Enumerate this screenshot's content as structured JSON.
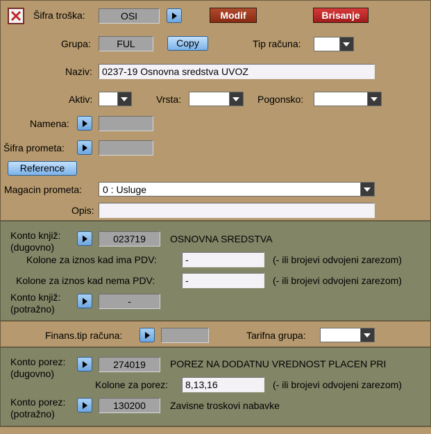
{
  "header": {
    "sifra_label": "Šifra troška:",
    "sifra_value": "OSI",
    "modif_label": "Modif",
    "brisanje_label": "Brisanje"
  },
  "grupa": {
    "label": "Grupa:",
    "value": "FUL",
    "copy_label": "Copy",
    "tip_label": "Tip računa:",
    "tip_value": ""
  },
  "naziv": {
    "label": "Naziv:",
    "value": "0237-19 Osnovna sredstva UVOZ"
  },
  "aktiv": {
    "label": "Aktiv:",
    "value": "",
    "vrsta_label": "Vrsta:",
    "vrsta_value": "",
    "pogonsko_label": "Pogonsko:",
    "pogonsko_value": ""
  },
  "namena": {
    "label": "Namena:",
    "value": ""
  },
  "sifra_prometa": {
    "label": "Šifra prometa:",
    "value": ""
  },
  "reference_label": "Reference",
  "magacin": {
    "label": "Magacin prometa:",
    "value": "0 : Usluge"
  },
  "opis": {
    "label": "Opis:",
    "value": ""
  },
  "konto": {
    "dugovno_label1": "Konto knjiž:",
    "dugovno_label2": "(dugovno)",
    "dugovno_value": "023719",
    "dugovno_name": "OSNOVNA SREDSTVA",
    "pdv_ima_label": "Kolone za iznos kad ima PDV:",
    "pdv_ima_value": "-",
    "pdv_nema_label": "Kolone za iznos kad nema PDV:",
    "pdv_nema_value": "-",
    "hint": "(- ili brojevi odvojeni zarezom)",
    "potrazno_label1": "Konto knjiž:",
    "potrazno_label2": "(potražno)",
    "potrazno_value": "-"
  },
  "finans": {
    "label": "Finans.tip računa:",
    "value": "",
    "tarifna_label": "Tarifna grupa:",
    "tarifna_value": ""
  },
  "porez": {
    "dugovno_label1": "Konto porez:",
    "dugovno_label2": "(dugovno)",
    "dugovno_value": "274019",
    "dugovno_name": "POREZ NA DODATNU VREDNOST PLACEN PRI",
    "kolone_label": "Kolone za porez:",
    "kolone_value": "8,13,16",
    "hint": "(- ili brojevi odvojeni zarezom)",
    "potrazno_label1": "Konto porez:",
    "potrazno_label2": "(potražno)",
    "potrazno_value": "130200",
    "potrazno_name": "Zavisne troskovi nabavke"
  },
  "colors": {
    "tan": "#b6996e",
    "olive": "#838567",
    "modif_red": "#a23a1e",
    "brisanje_red": "#c42b2b"
  }
}
